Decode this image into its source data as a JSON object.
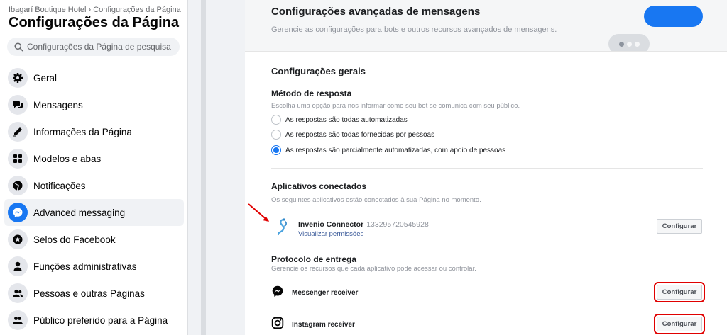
{
  "sidebar": {
    "breadcrumb": "Ibagarí Boutique Hotel › Configurações da Página",
    "title": "Configurações da Página",
    "search_placeholder": "Configurações da Página de pesquisa",
    "items": [
      {
        "label": "Geral",
        "icon": "gear-icon"
      },
      {
        "label": "Mensagens",
        "icon": "chat-bubbles-icon"
      },
      {
        "label": "Informações da Página",
        "icon": "pencil-icon"
      },
      {
        "label": "Modelos e abas",
        "icon": "grid-icon"
      },
      {
        "label": "Notificações",
        "icon": "globe-icon"
      },
      {
        "label": "Advanced messaging",
        "icon": "messenger-icon",
        "active": true
      },
      {
        "label": "Selos do Facebook",
        "icon": "star-badge-icon"
      },
      {
        "label": "Funções administrativas",
        "icon": "person-icon"
      },
      {
        "label": "Pessoas e outras Páginas",
        "icon": "people-icon"
      },
      {
        "label": "Público preferido para a Página",
        "icon": "audience-icon"
      }
    ]
  },
  "advanced": {
    "title": "Configurações avançadas de mensagens",
    "subtitle": "Gerencie as configurações para bots e outros recursos avançados de mensagens."
  },
  "general": {
    "title": "Configurações gerais",
    "response_method": {
      "title": "Método de resposta",
      "description": "Escolha uma opção para nos informar como seu bot se comunica com seu público.",
      "options": [
        {
          "label": "As respostas são todas automatizadas",
          "checked": false
        },
        {
          "label": "As respostas são todas fornecidas por pessoas",
          "checked": false
        },
        {
          "label": "As respostas são parcialmente automatizadas, com apoio de pessoas",
          "checked": true
        }
      ]
    }
  },
  "connected_apps": {
    "title": "Aplicativos conectados",
    "description": "Os seguintes aplicativos estão conectados à sua Página no momento.",
    "app": {
      "name": "Invenio Connector",
      "id": "133295720545928",
      "link": "Visualizar permissões",
      "button": "Configurar"
    }
  },
  "delivery": {
    "title": "Protocolo de entrega",
    "description": "Gerencie os recursos que cada aplicativo pode acessar ou controlar.",
    "receivers": [
      {
        "label": "Messenger receiver",
        "icon": "messenger-icon",
        "button": "Configurar"
      },
      {
        "label": "Instagram receiver",
        "icon": "instagram-icon",
        "button": "Configurar"
      }
    ]
  },
  "colors": {
    "accent": "#1877f2",
    "annotation_red": "#e00000"
  }
}
